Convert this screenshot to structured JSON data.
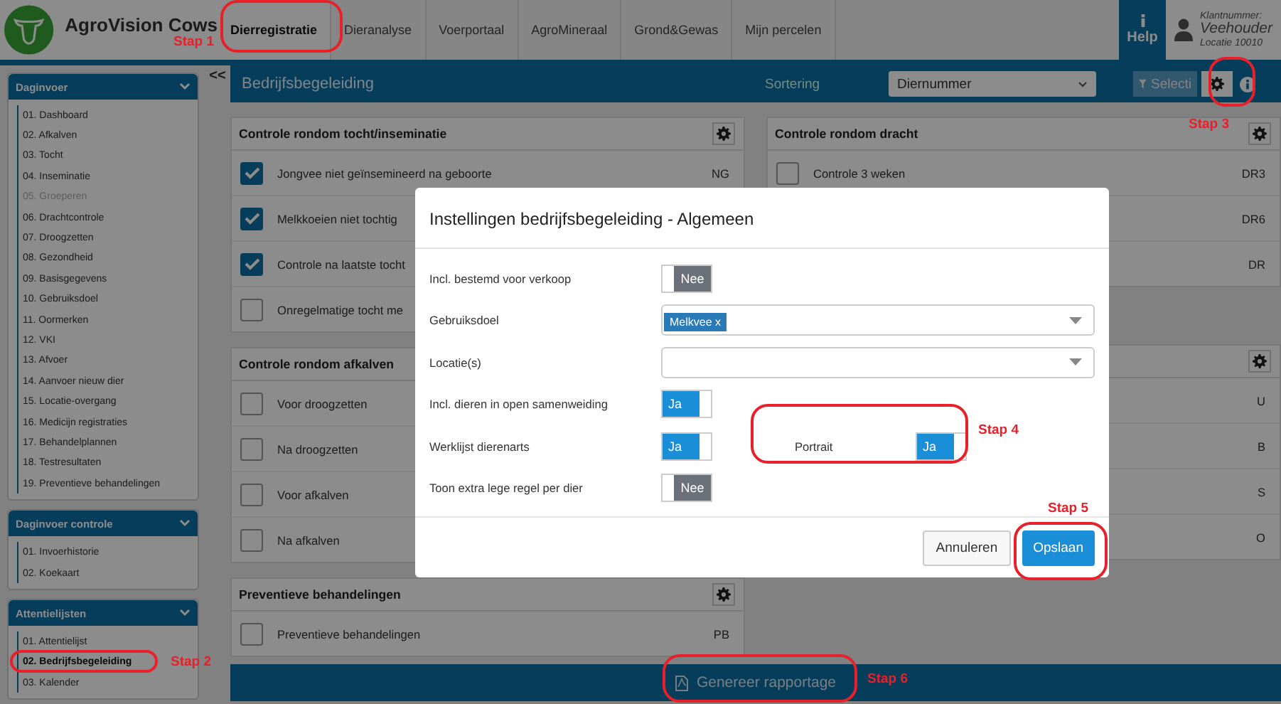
{
  "app": {
    "title": "AgroVision Cows"
  },
  "nav_tabs": [
    {
      "label": "Dierregistratie",
      "selected": true
    },
    {
      "label": "Dieranalyse",
      "selected": false
    },
    {
      "label": "Voerportaal",
      "selected": false
    },
    {
      "label": "AgroMineraal",
      "selected": false
    },
    {
      "label": "Grond&Gewas",
      "selected": false
    },
    {
      "label": "Mijn percelen",
      "selected": false
    }
  ],
  "help": {
    "label": "Help"
  },
  "user": {
    "customer_number": "Klantnummer:",
    "role": "Veehouder",
    "location": "Locatie 10010"
  },
  "sidebar": [
    {
      "title": "Daginvoer",
      "items": [
        {
          "label": "01. Dashboard",
          "disabled": false,
          "selected": false
        },
        {
          "label": "02. Afkalven",
          "disabled": false,
          "selected": false
        },
        {
          "label": "03. Tocht",
          "disabled": false,
          "selected": false
        },
        {
          "label": "04. Inseminatie",
          "disabled": false,
          "selected": false
        },
        {
          "label": "05. Groeperen",
          "disabled": true,
          "selected": false
        },
        {
          "label": "06. Drachtcontrole",
          "disabled": false,
          "selected": false
        },
        {
          "label": "07. Droogzetten",
          "disabled": false,
          "selected": false
        },
        {
          "label": "08. Gezondheid",
          "disabled": false,
          "selected": false
        },
        {
          "label": "09. Basisgegevens",
          "disabled": false,
          "selected": false
        },
        {
          "label": "10. Gebruiksdoel",
          "disabled": false,
          "selected": false
        },
        {
          "label": "11. Oormerken",
          "disabled": false,
          "selected": false
        },
        {
          "label": "12. VKI",
          "disabled": false,
          "selected": false
        },
        {
          "label": "13. Afvoer",
          "disabled": false,
          "selected": false
        },
        {
          "label": "14. Aanvoer nieuw dier",
          "disabled": false,
          "selected": false
        },
        {
          "label": "15. Locatie-overgang",
          "disabled": false,
          "selected": false
        },
        {
          "label": "16. Medicijn registraties",
          "disabled": false,
          "selected": false
        },
        {
          "label": "17. Behandelplannen",
          "disabled": false,
          "selected": false
        },
        {
          "label": "18. Testresultaten",
          "disabled": false,
          "selected": false
        },
        {
          "label": "19. Preventieve behandelingen",
          "disabled": false,
          "selected": false
        }
      ]
    },
    {
      "title": "Daginvoer controle",
      "items": [
        {
          "label": "01. Invoerhistorie",
          "disabled": false,
          "selected": false
        },
        {
          "label": "02. Koekaart",
          "disabled": false,
          "selected": false
        }
      ]
    },
    {
      "title": "Attentielijsten",
      "items": [
        {
          "label": "01. Attentielijst",
          "disabled": false,
          "selected": false
        },
        {
          "label": "02. Bedrijfsbegeleiding",
          "disabled": false,
          "selected": true
        },
        {
          "label": "03. Kalender",
          "disabled": false,
          "selected": false
        }
      ]
    }
  ],
  "collapse": "<<",
  "toolbar": {
    "title": "Bedrijfsbegeleiding",
    "sort_label": "Sortering",
    "sort_value": "Diernummer",
    "selection_button": "Selecti"
  },
  "left_cards": [
    {
      "title": "Controle rondom tocht/inseminatie",
      "rows": [
        {
          "label": "Jongvee niet geïnsemineerd na geboorte",
          "code": "NG",
          "checked": true
        },
        {
          "label": "Melkkoeien niet tochtig",
          "checked": true
        },
        {
          "label": "Controle na laatste tocht",
          "checked": true
        },
        {
          "label": "Onregelmatige tocht me",
          "checked": false
        }
      ]
    },
    {
      "title": "Controle rondom afkalven",
      "rows": [
        {
          "label": "Voor droogzetten",
          "checked": false
        },
        {
          "label": "Na droogzetten",
          "checked": false
        },
        {
          "label": "Voor afkalven",
          "checked": false
        },
        {
          "label": "Na afkalven",
          "checked": false
        }
      ]
    },
    {
      "title": "Preventieve behandelingen",
      "rows": [
        {
          "label": "Preventieve behandelingen",
          "code": "PB",
          "checked": false
        }
      ]
    }
  ],
  "right_cards": [
    {
      "title": "Controle rondom dracht",
      "rows": [
        {
          "label": "Controle 3 weken",
          "code": "DR3",
          "checked": false
        },
        {
          "code": "DR6"
        },
        {
          "code": "DR"
        }
      ]
    },
    {
      "rows": [
        {
          "code": "U"
        },
        {
          "code": "B"
        },
        {
          "code": "S"
        },
        {
          "code": "O"
        }
      ]
    }
  ],
  "generate_button": "Genereer rapportage",
  "dialog": {
    "title": "Instellingen bedrijfsbegeleiding - Algemeen",
    "fields": [
      {
        "kind": "toggle",
        "label": "Incl. bestemd voor verkoop",
        "on": false,
        "value": "Nee"
      },
      {
        "kind": "select",
        "label": "Gebruiksdoel",
        "chips": [
          "Melkvee x"
        ]
      },
      {
        "kind": "select",
        "label": "Locatie(s)"
      },
      {
        "kind": "toggle",
        "label": "Incl. dieren in open samenweiding",
        "on": true,
        "value": "Ja"
      },
      {
        "kind": "toggle",
        "label": "Werklijst dierenarts",
        "on": true,
        "value": "Ja",
        "side": {
          "label": "Portrait",
          "on": true,
          "value": "Ja"
        }
      },
      {
        "kind": "toggle",
        "label": "Toon extra lege regel per dier",
        "on": false,
        "value": "Nee"
      }
    ],
    "buttons": [
      {
        "label": "Annuleren",
        "kind": "secondary"
      },
      {
        "label": "Opslaan",
        "kind": "primary"
      }
    ]
  },
  "annotations": [
    "Stap 1",
    "Stap 2",
    "Stap 3",
    "Stap 4",
    "Stap 5",
    "Stap 6"
  ]
}
